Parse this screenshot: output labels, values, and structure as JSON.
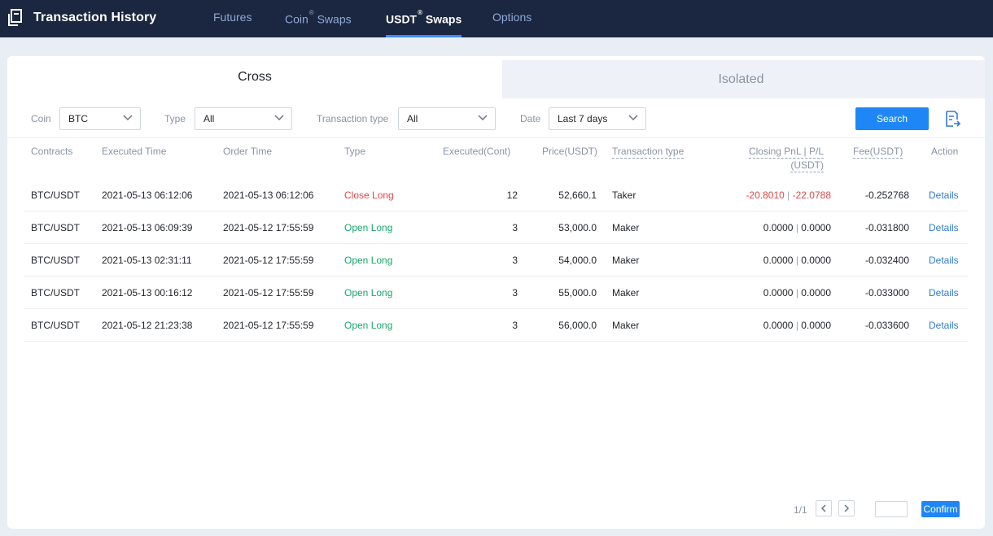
{
  "header": {
    "title": "Transaction History",
    "tabs": [
      {
        "label": "Futures",
        "sup": ""
      },
      {
        "label": "Coin",
        "sup": "®",
        "suffix": " Swaps"
      },
      {
        "label": "USDT",
        "sup": "®",
        "suffix": " Swaps"
      },
      {
        "label": "Options",
        "sup": ""
      }
    ],
    "active_tab": "USDT Swaps"
  },
  "mode_tabs": {
    "cross": "Cross",
    "isolated": "Isolated",
    "active": "Cross"
  },
  "filters": {
    "coin_label": "Coin",
    "coin_value": "BTC",
    "type_label": "Type",
    "type_value": "All",
    "txtype_label": "Transaction type",
    "txtype_value": "All",
    "date_label": "Date",
    "date_value": "Last 7 days",
    "search_label": "Search"
  },
  "columns": {
    "contracts": "Contracts",
    "executed_time": "Executed Time",
    "order_time": "Order Time",
    "type": "Type",
    "executed": "Executed(Cont)",
    "price": "Price(USDT)",
    "tx_type": "Transaction type",
    "pnl": "Closing PnL | P/L",
    "pnl_unit": "(USDT)",
    "fee": "Fee(USDT)",
    "action": "Action"
  },
  "rows": [
    {
      "contract": "BTC/USDT",
      "executed_time": "2021-05-13 06:12:06",
      "order_time": "2021-05-13 06:12:06",
      "type": "Close Long",
      "executed": "12",
      "price": "52,660.1",
      "tx_type": "Taker",
      "pnl": "-20.8010",
      "pl": "-22.0788",
      "fee": "-0.252768",
      "action": "Details"
    },
    {
      "contract": "BTC/USDT",
      "executed_time": "2021-05-13 06:09:39",
      "order_time": "2021-05-12 17:55:59",
      "type": "Open Long",
      "executed": "3",
      "price": "53,000.0",
      "tx_type": "Maker",
      "pnl": "0.0000",
      "pl": "0.0000",
      "fee": "-0.031800",
      "action": "Details"
    },
    {
      "contract": "BTC/USDT",
      "executed_time": "2021-05-13 02:31:11",
      "order_time": "2021-05-12 17:55:59",
      "type": "Open Long",
      "executed": "3",
      "price": "54,000.0",
      "tx_type": "Maker",
      "pnl": "0.0000",
      "pl": "0.0000",
      "fee": "-0.032400",
      "action": "Details"
    },
    {
      "contract": "BTC/USDT",
      "executed_time": "2021-05-13 00:16:12",
      "order_time": "2021-05-12 17:55:59",
      "type": "Open Long",
      "executed": "3",
      "price": "55,000.0",
      "tx_type": "Maker",
      "pnl": "0.0000",
      "pl": "0.0000",
      "fee": "-0.033000",
      "action": "Details"
    },
    {
      "contract": "BTC/USDT",
      "executed_time": "2021-05-12 21:23:38",
      "order_time": "2021-05-12 17:55:59",
      "type": "Open Long",
      "executed": "3",
      "price": "56,000.0",
      "tx_type": "Maker",
      "pnl": "0.0000",
      "pl": "0.0000",
      "fee": "-0.033600",
      "action": "Details"
    }
  ],
  "pagination": {
    "page_text": "1/1",
    "input_value": "",
    "confirm_label": "Confirm"
  },
  "colors": {
    "accent": "#1f87f5",
    "header_bg": "#1b2740",
    "loss": "#e04747",
    "gain": "#18a86b"
  },
  "icons": {
    "brand": "document-icon",
    "export": "export-file-icon",
    "prev": "chevron-left-icon",
    "next": "chevron-right-icon"
  }
}
